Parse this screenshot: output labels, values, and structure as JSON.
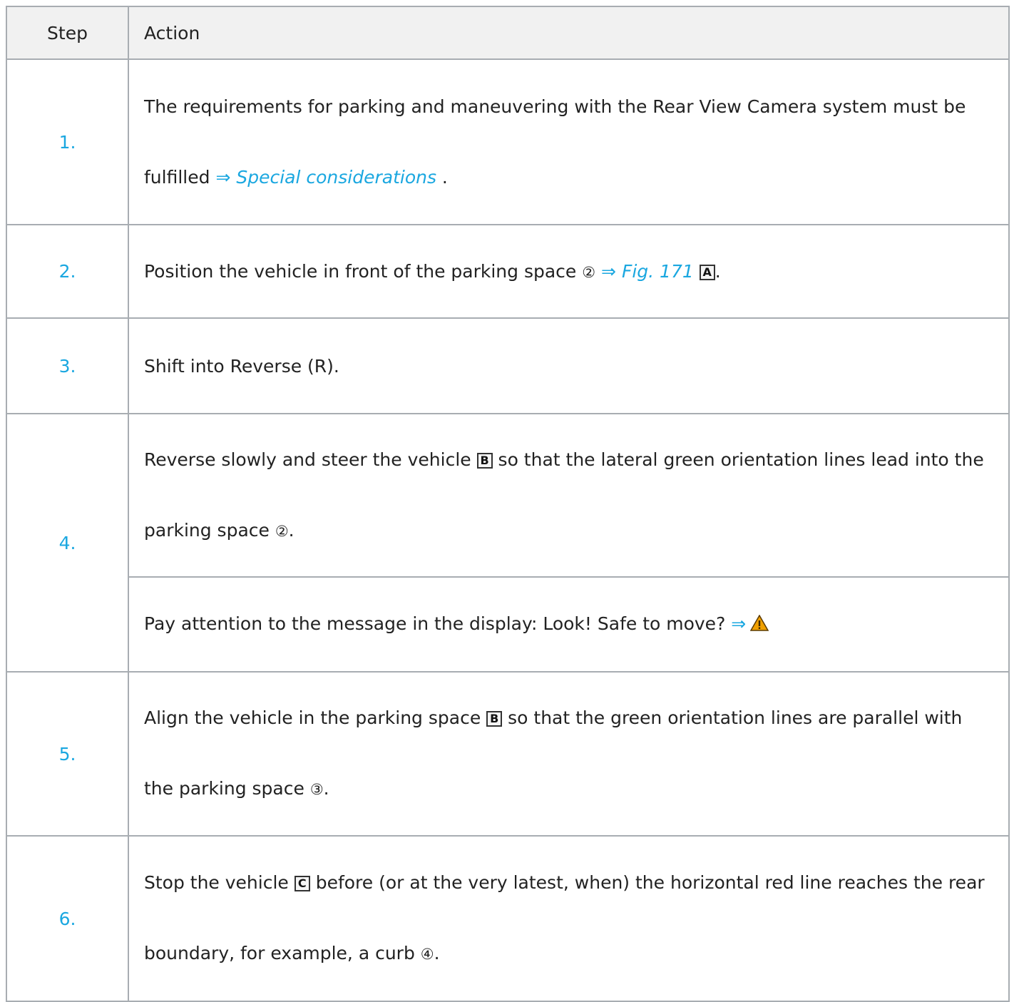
{
  "table": {
    "headers": {
      "step": "Step",
      "action": "Action"
    },
    "rows": [
      {
        "step": "1.",
        "text1": "The requirements for parking and maneuvering with the Rear View Camera system must be fulfilled ",
        "arrow": "⇒",
        "link": "Special considerations",
        "end": " ."
      },
      {
        "step": "2.",
        "text1": "Position the vehicle in front of the parking space ",
        "circled": "②",
        "arrow": "⇒",
        "link": "Fig. 171",
        "key": "A",
        "end": "."
      },
      {
        "step": "3.",
        "text1": "Shift into Reverse (R)."
      },
      {
        "step": "4.",
        "sub1": {
          "text1": "Reverse slowly and steer the vehicle ",
          "key": "B",
          "text2": " so that the lateral green orientation lines lead into the parking space ",
          "circled": "②",
          "end": "."
        },
        "sub2": {
          "text1": "Pay attention to the message in the display: Look! Safe to move? ",
          "arrow": "⇒",
          "warning_icon": "warning-triangle-icon"
        }
      },
      {
        "step": "5.",
        "text1": "Align the vehicle in the parking space ",
        "key": "B",
        "text2": " so that the green orientation lines are parallel with the parking space ",
        "circled": "③",
        "end": "."
      },
      {
        "step": "6.",
        "text1": "Stop the vehicle ",
        "key": "C",
        "text2": " before (or at the very latest, when) the horizontal red line reaches the rear boundary, for example, a curb ",
        "circled": "④",
        "end": "."
      }
    ]
  },
  "colors": {
    "link": "#1aa7e0",
    "border": "#a8adb2",
    "header_bg": "#f1f1f1",
    "warning": "#f0a000"
  }
}
